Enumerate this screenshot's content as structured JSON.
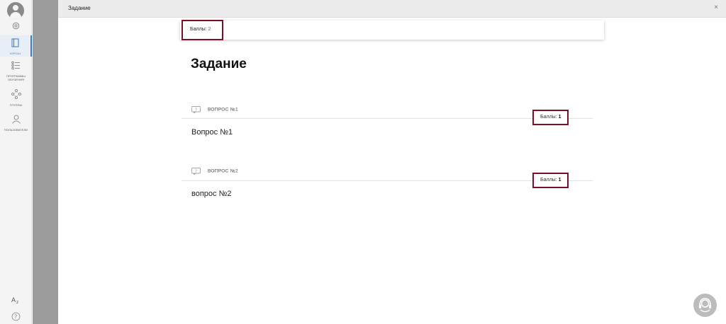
{
  "sidebar": {
    "items": [
      {
        "label": "КУРСЫ",
        "icon": "book-icon",
        "active": true
      },
      {
        "label": "ПРОГРАММЫ ОБУЧЕНИЯ",
        "icon": "list-icon",
        "active": false
      },
      {
        "label": "ГРУППЫ",
        "icon": "group-icon",
        "active": false
      },
      {
        "label": "ПОЛЬЗОВАТЕЛИ",
        "icon": "users-icon",
        "active": false
      }
    ],
    "bottom_icons": [
      "language-icon",
      "help-circle-icon"
    ]
  },
  "header": {
    "title": "Задание",
    "close_glyph": "×"
  },
  "score": {
    "label": "Баллы:",
    "value": "2"
  },
  "page_title": "Задание",
  "questions": [
    {
      "heading": "ВОПРОС №1",
      "text": "Вопрос №1",
      "points_label": "Баллы:",
      "points": "1"
    },
    {
      "heading": "ВОПРОС №2",
      "text": "вопрос №2",
      "points_label": "Баллы:",
      "points": "1"
    }
  ],
  "colors": {
    "accent": "#3a7bc8",
    "highlight_border": "#7a1028",
    "gutter": "#9b9b9b"
  }
}
